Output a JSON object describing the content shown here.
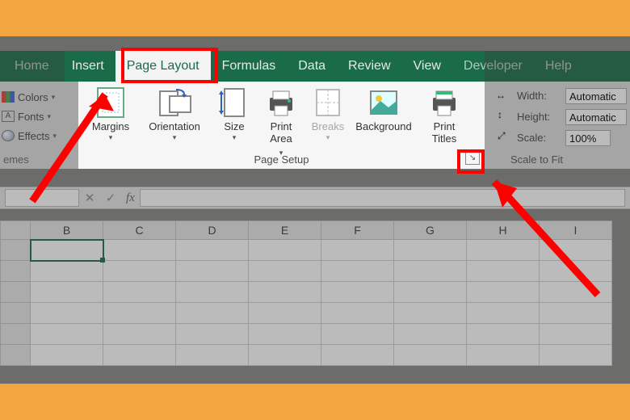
{
  "tabs": {
    "home": "Home",
    "insert": "Insert",
    "page_layout": "Page Layout",
    "formulas": "Formulas",
    "data": "Data",
    "review": "Review",
    "view": "View",
    "developer": "Developer",
    "help": "Help"
  },
  "themes": {
    "colors": "Colors",
    "fonts": "Fonts",
    "effects": "Effects",
    "group": "emes"
  },
  "page_setup": {
    "margins": "Margins",
    "orientation": "Orientation",
    "size": "Size",
    "print_area": "Print\nArea",
    "breaks": "Breaks",
    "background": "Background",
    "print_titles": "Print\nTitles",
    "group": "Page Setup"
  },
  "scale": {
    "width_label": "Width:",
    "width_value": "Automatic",
    "height_label": "Height:",
    "height_value": "Automatic",
    "scale_label": "Scale:",
    "scale_value": "100%",
    "group": "Scale to Fit"
  },
  "formula_bar": {
    "fx": "fx",
    "cancel": "✕",
    "enter": "✓"
  },
  "columns": [
    "",
    "B",
    "C",
    "D",
    "E",
    "F",
    "G",
    "H",
    "I"
  ],
  "dropdown_glyph": "▾"
}
